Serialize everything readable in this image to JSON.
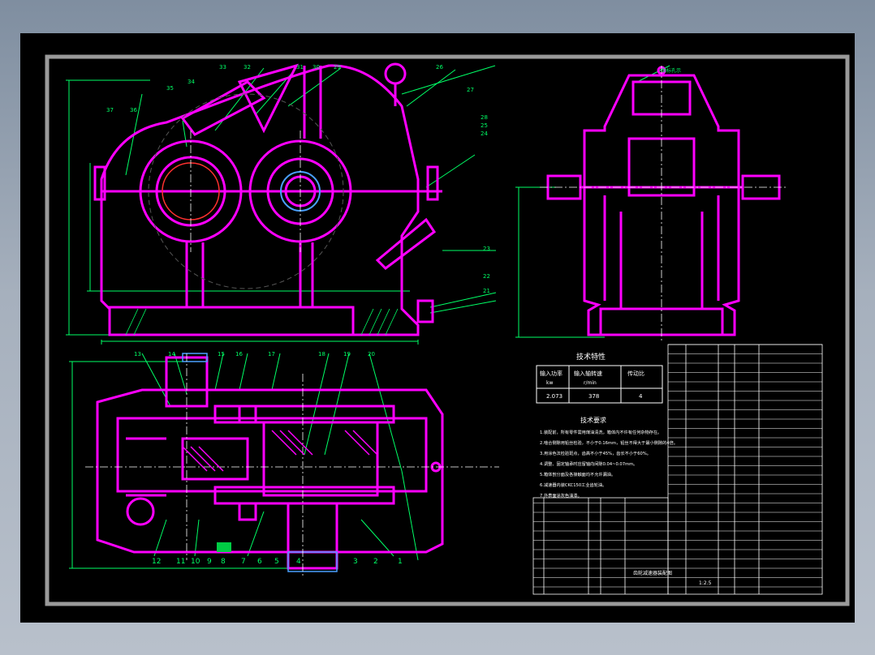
{
  "title_block": {
    "tech_char_title": "技术特性",
    "tech_char_headers": [
      "输入功率",
      "输入轴转速",
      "传动比"
    ],
    "tech_char_units": [
      "kw",
      "r/min",
      ""
    ],
    "tech_char_values": [
      "2.073",
      "378",
      "4"
    ],
    "tech_req_title": "技术要求",
    "tech_req_lines": [
      "1.装配前，所有零件需用煤油清洗，箱体内不许有任何杂物存在。",
      "2.啮合侧隙用铅丝检验，不小于0.16mm，铅丝不得大于最小侧隙的4倍。",
      "3.用涂色法检验斑点，齿高不小于45%，齿长不小于60%。",
      "4.调整、固定轴承时应留轴向间隙0.04~0.07mm。",
      "5.箱体剖分面及各接触面均不允许漏油。",
      "6.减速器内装CKC150工业齿轮油。",
      "7.外表面涂灰色油漆。"
    ],
    "drawing_name": "齿轮减速器装配图",
    "scale": "1:2.5"
  },
  "part_labels": {
    "top_view": [
      "33",
      "32",
      "31",
      "30",
      "29",
      "26",
      "35",
      "34",
      "37",
      "36",
      "27",
      "28",
      "25",
      "24",
      "23",
      "22",
      "21"
    ],
    "bottom_view_top": [
      "13",
      "14",
      "15",
      "16",
      "17",
      "18",
      "19",
      "20"
    ],
    "bottom_view_bottom": [
      "12",
      "11",
      "10",
      "9",
      "8",
      "7",
      "6",
      "5",
      "4",
      "3",
      "2",
      "1"
    ],
    "side_view_note": "油标孔示"
  },
  "colors": {
    "sheet_bg": "#000000",
    "frame": "#9a9a9a",
    "part_outline": "#ff00ff",
    "dimension": "#00ff66",
    "centerline": "#ffffff",
    "text": "#ffffff",
    "accent_red": "#ff3030",
    "accent_blue": "#4aa0ff"
  }
}
